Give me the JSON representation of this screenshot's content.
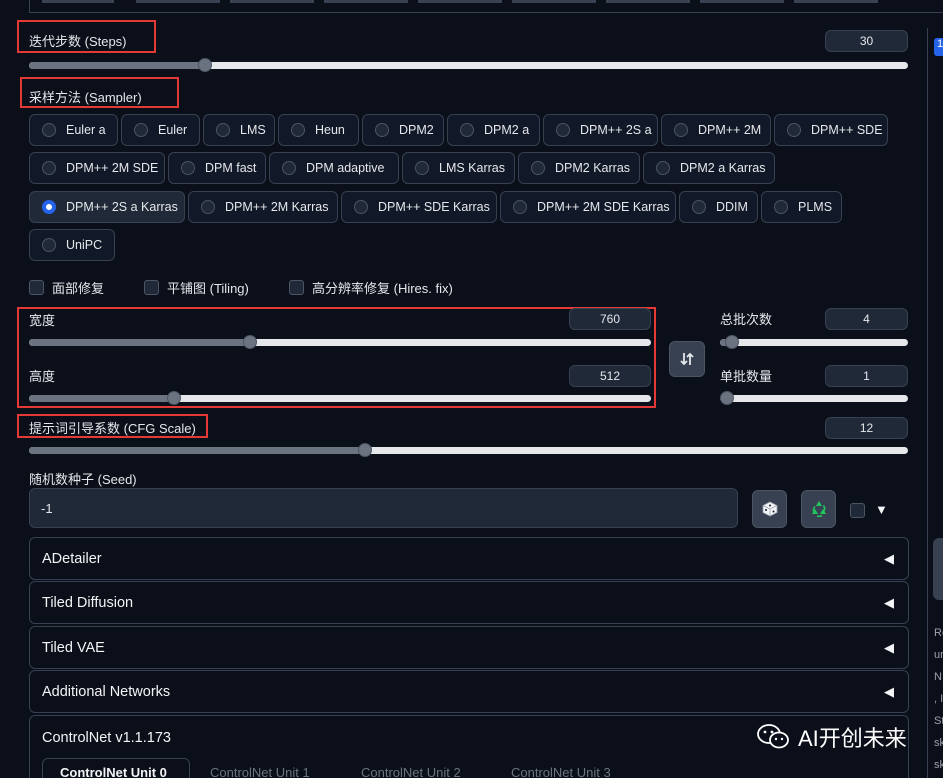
{
  "steps": {
    "label": "迭代步数 (Steps)",
    "value": "30",
    "fraction": 0.2
  },
  "sampler": {
    "label": "采样方法 (Sampler)",
    "options": [
      "Euler a",
      "Euler",
      "LMS",
      "Heun",
      "DPM2",
      "DPM2 a",
      "DPM++ 2S a",
      "DPM++ 2M",
      "DPM++ SDE",
      "DPM++ 2M SDE",
      "DPM fast",
      "DPM adaptive",
      "LMS Karras",
      "DPM2 Karras",
      "DPM2 a Karras",
      "DPM++ 2S a Karras",
      "DPM++ 2M Karras",
      "DPM++ SDE Karras",
      "DPM++ 2M SDE Karras",
      "DDIM",
      "PLMS",
      "UniPC"
    ],
    "selected": "DPM++ 2S a Karras"
  },
  "checkboxes": {
    "face_restore": "面部修复",
    "tiling": "平铺图 (Tiling)",
    "hires_fix": "高分辨率修复 (Hires. fix)"
  },
  "width": {
    "label": "宽度",
    "value": "760",
    "fraction": 0.34
  },
  "height": {
    "label": "高度",
    "value": "512",
    "fraction": 0.22
  },
  "swap_icon": "swap-icon",
  "batch_count": {
    "label": "总批次数",
    "value": "4",
    "fraction": 0.03
  },
  "batch_size": {
    "label": "单批数量",
    "value": "1",
    "fraction": 0.0
  },
  "cfg_scale": {
    "label": "提示词引导系数 (CFG Scale)",
    "value": "12",
    "fraction": 0.38
  },
  "seed": {
    "label": "随机数种子 (Seed)",
    "value": "-1"
  },
  "accordions": {
    "adetailer": "ADetailer",
    "tiled_diffusion": "Tiled Diffusion",
    "tiled_vae": "Tiled VAE",
    "additional_networks": "Additional Networks"
  },
  "controlnet": {
    "title": "ControlNet v1.1.173",
    "tabs": [
      "ControlNet Unit 0",
      "ControlNet Unit 1",
      "ControlNet Unit 2",
      "ControlNet Unit 3"
    ]
  },
  "watermark": "AI开创未来",
  "right_panel_fragments": [
    "1",
    "Re",
    "ur",
    "N",
    ", I",
    "St",
    "sk",
    "sk"
  ],
  "colors": {
    "accent": "#2563eb",
    "highlight_box": "#e53935",
    "recycle": "#22c55e"
  }
}
